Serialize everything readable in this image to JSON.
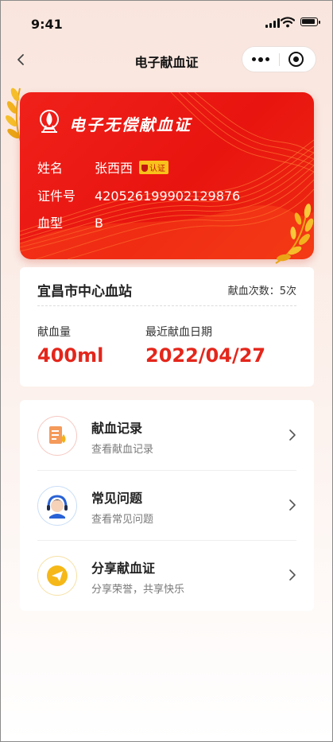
{
  "status_bar": {
    "time": "9:41"
  },
  "nav": {
    "title": "电子献血证"
  },
  "card": {
    "title": "电子无偿献血证",
    "rows": [
      {
        "label": "姓名",
        "value": "张西西",
        "badge": "认证"
      },
      {
        "label": "证件号",
        "value": "420526199902129876"
      },
      {
        "label": "血型",
        "value": "B"
      }
    ]
  },
  "station": {
    "name": "宜昌市中心血站",
    "count_text": "献血次数：5次",
    "amount_label": "献血量",
    "amount_value": "400ml",
    "date_label": "最近献血日期",
    "date_value": "2022/04/27"
  },
  "menu": [
    {
      "title": "献血记录",
      "subtitle": "查看献血记录",
      "icon": "record-icon"
    },
    {
      "title": "常见问题",
      "subtitle": "查看常见问题",
      "icon": "customer-service-icon"
    },
    {
      "title": "分享献血证",
      "subtitle": "分享荣誉，共享快乐",
      "icon": "share-icon"
    }
  ],
  "colors": {
    "brand_red": "#e4261b",
    "card_red": "#f0211a",
    "gold": "#f4b416"
  }
}
